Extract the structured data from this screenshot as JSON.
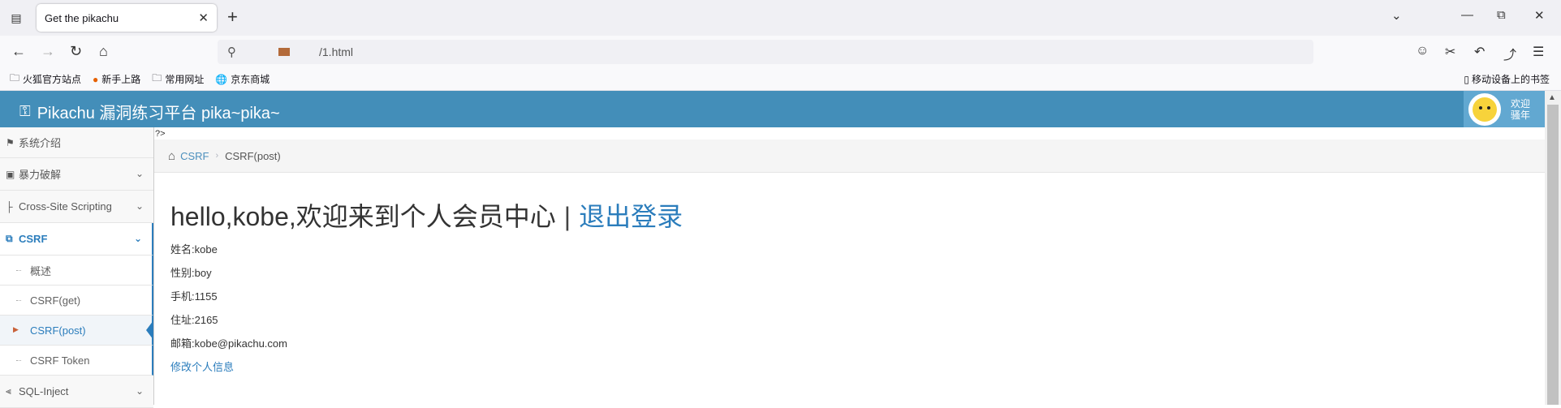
{
  "browser": {
    "tab_title": "Get the pikachu",
    "url": "/1.html",
    "bookmarks": [
      "火狐官方站点",
      "新手上路",
      "常用网址",
      "京东商城"
    ],
    "mobile_bookmarks": "移动设备上的书签"
  },
  "header": {
    "brand": "Pikachu 漏洞练习平台 pika~pika~",
    "welcome_line1": "欢迎",
    "welcome_line2": "骚年"
  },
  "sidebar": {
    "items": [
      {
        "label": "系统介绍"
      },
      {
        "label": "暴力破解"
      },
      {
        "label": "Cross-Site Scripting"
      },
      {
        "label": "CSRF"
      },
      {
        "label": "SQL-Inject"
      }
    ],
    "csrf_sub": [
      "概述",
      "CSRF(get)",
      "CSRF(post)",
      "CSRF Token"
    ]
  },
  "main": {
    "artifact": "?>",
    "breadcrumb": {
      "link": "CSRF",
      "current": "CSRF(post)"
    },
    "greeting": "hello,kobe,欢迎来到个人会员中心",
    "separator": "|",
    "logout": "退出登录",
    "info": [
      "姓名:kobe",
      "性别:boy",
      "手机:1155",
      "住址:2165",
      "邮箱:kobe@pikachu.com"
    ],
    "edit_link": "修改个人信息"
  },
  "colors": {
    "header_bg": "#438eb9",
    "link": "#2b7dbc",
    "active_accent": "#2b7dbc"
  }
}
